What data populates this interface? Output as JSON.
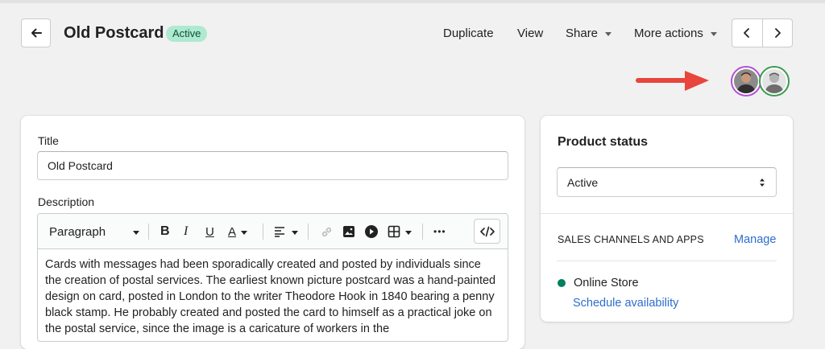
{
  "header": {
    "title": "Old Postcard",
    "status_badge": "Active",
    "actions": {
      "duplicate": "Duplicate",
      "view": "View",
      "share": "Share",
      "more_actions": "More actions"
    }
  },
  "main_card": {
    "title_label": "Title",
    "title_value": "Old Postcard",
    "description_label": "Description",
    "toolbar": {
      "paragraph_select": "Paragraph",
      "bold": "B",
      "italic": "I",
      "underline": "U",
      "text_color": "A",
      "more": "•••"
    },
    "description_text": "Cards with messages had been sporadically created and posted by individuals since the creation of postal services. The earliest known picture postcard was a hand-painted design on card, posted in London to the writer Theodore Hook in 1840 bearing a penny black stamp. He probably created and posted the card to himself as a practical joke on the postal service, since the image is a caricature of workers in the"
  },
  "side_card": {
    "heading": "Product status",
    "status_select": "Active",
    "channels_heading": "SALES CHANNELS AND APPS",
    "manage_link": "Manage",
    "channel_name": "Online Store",
    "schedule_link": "Schedule availability"
  },
  "colors": {
    "badge_bg": "#aee9d1",
    "link": "#2c6ecb",
    "status_dot": "#007f5f",
    "arrow": "#e8453c",
    "avatar_ring_1": "#b44ed6",
    "avatar_ring_2": "#3a9c4f"
  }
}
